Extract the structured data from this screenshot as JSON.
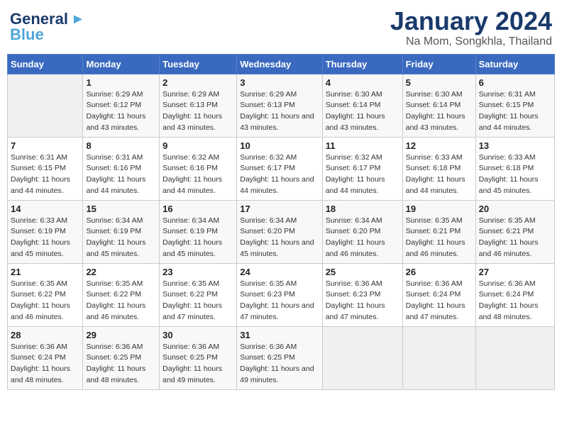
{
  "header": {
    "logo_line1": "General",
    "logo_line2": "Blue",
    "title": "January 2024",
    "subtitle": "Na Mom, Songkhla, Thailand"
  },
  "columns": [
    "Sunday",
    "Monday",
    "Tuesday",
    "Wednesday",
    "Thursday",
    "Friday",
    "Saturday"
  ],
  "weeks": [
    [
      {
        "day": "",
        "sunrise": "",
        "sunset": "",
        "daylight": ""
      },
      {
        "day": "1",
        "sunrise": "Sunrise: 6:29 AM",
        "sunset": "Sunset: 6:12 PM",
        "daylight": "Daylight: 11 hours and 43 minutes."
      },
      {
        "day": "2",
        "sunrise": "Sunrise: 6:29 AM",
        "sunset": "Sunset: 6:13 PM",
        "daylight": "Daylight: 11 hours and 43 minutes."
      },
      {
        "day": "3",
        "sunrise": "Sunrise: 6:29 AM",
        "sunset": "Sunset: 6:13 PM",
        "daylight": "Daylight: 11 hours and 43 minutes."
      },
      {
        "day": "4",
        "sunrise": "Sunrise: 6:30 AM",
        "sunset": "Sunset: 6:14 PM",
        "daylight": "Daylight: 11 hours and 43 minutes."
      },
      {
        "day": "5",
        "sunrise": "Sunrise: 6:30 AM",
        "sunset": "Sunset: 6:14 PM",
        "daylight": "Daylight: 11 hours and 43 minutes."
      },
      {
        "day": "6",
        "sunrise": "Sunrise: 6:31 AM",
        "sunset": "Sunset: 6:15 PM",
        "daylight": "Daylight: 11 hours and 44 minutes."
      }
    ],
    [
      {
        "day": "7",
        "sunrise": "Sunrise: 6:31 AM",
        "sunset": "Sunset: 6:15 PM",
        "daylight": "Daylight: 11 hours and 44 minutes."
      },
      {
        "day": "8",
        "sunrise": "Sunrise: 6:31 AM",
        "sunset": "Sunset: 6:16 PM",
        "daylight": "Daylight: 11 hours and 44 minutes."
      },
      {
        "day": "9",
        "sunrise": "Sunrise: 6:32 AM",
        "sunset": "Sunset: 6:16 PM",
        "daylight": "Daylight: 11 hours and 44 minutes."
      },
      {
        "day": "10",
        "sunrise": "Sunrise: 6:32 AM",
        "sunset": "Sunset: 6:17 PM",
        "daylight": "Daylight: 11 hours and 44 minutes."
      },
      {
        "day": "11",
        "sunrise": "Sunrise: 6:32 AM",
        "sunset": "Sunset: 6:17 PM",
        "daylight": "Daylight: 11 hours and 44 minutes."
      },
      {
        "day": "12",
        "sunrise": "Sunrise: 6:33 AM",
        "sunset": "Sunset: 6:18 PM",
        "daylight": "Daylight: 11 hours and 44 minutes."
      },
      {
        "day": "13",
        "sunrise": "Sunrise: 6:33 AM",
        "sunset": "Sunset: 6:18 PM",
        "daylight": "Daylight: 11 hours and 45 minutes."
      }
    ],
    [
      {
        "day": "14",
        "sunrise": "Sunrise: 6:33 AM",
        "sunset": "Sunset: 6:19 PM",
        "daylight": "Daylight: 11 hours and 45 minutes."
      },
      {
        "day": "15",
        "sunrise": "Sunrise: 6:34 AM",
        "sunset": "Sunset: 6:19 PM",
        "daylight": "Daylight: 11 hours and 45 minutes."
      },
      {
        "day": "16",
        "sunrise": "Sunrise: 6:34 AM",
        "sunset": "Sunset: 6:19 PM",
        "daylight": "Daylight: 11 hours and 45 minutes."
      },
      {
        "day": "17",
        "sunrise": "Sunrise: 6:34 AM",
        "sunset": "Sunset: 6:20 PM",
        "daylight": "Daylight: 11 hours and 45 minutes."
      },
      {
        "day": "18",
        "sunrise": "Sunrise: 6:34 AM",
        "sunset": "Sunset: 6:20 PM",
        "daylight": "Daylight: 11 hours and 46 minutes."
      },
      {
        "day": "19",
        "sunrise": "Sunrise: 6:35 AM",
        "sunset": "Sunset: 6:21 PM",
        "daylight": "Daylight: 11 hours and 46 minutes."
      },
      {
        "day": "20",
        "sunrise": "Sunrise: 6:35 AM",
        "sunset": "Sunset: 6:21 PM",
        "daylight": "Daylight: 11 hours and 46 minutes."
      }
    ],
    [
      {
        "day": "21",
        "sunrise": "Sunrise: 6:35 AM",
        "sunset": "Sunset: 6:22 PM",
        "daylight": "Daylight: 11 hours and 46 minutes."
      },
      {
        "day": "22",
        "sunrise": "Sunrise: 6:35 AM",
        "sunset": "Sunset: 6:22 PM",
        "daylight": "Daylight: 11 hours and 46 minutes."
      },
      {
        "day": "23",
        "sunrise": "Sunrise: 6:35 AM",
        "sunset": "Sunset: 6:22 PM",
        "daylight": "Daylight: 11 hours and 47 minutes."
      },
      {
        "day": "24",
        "sunrise": "Sunrise: 6:35 AM",
        "sunset": "Sunset: 6:23 PM",
        "daylight": "Daylight: 11 hours and 47 minutes."
      },
      {
        "day": "25",
        "sunrise": "Sunrise: 6:36 AM",
        "sunset": "Sunset: 6:23 PM",
        "daylight": "Daylight: 11 hours and 47 minutes."
      },
      {
        "day": "26",
        "sunrise": "Sunrise: 6:36 AM",
        "sunset": "Sunset: 6:24 PM",
        "daylight": "Daylight: 11 hours and 47 minutes."
      },
      {
        "day": "27",
        "sunrise": "Sunrise: 6:36 AM",
        "sunset": "Sunset: 6:24 PM",
        "daylight": "Daylight: 11 hours and 48 minutes."
      }
    ],
    [
      {
        "day": "28",
        "sunrise": "Sunrise: 6:36 AM",
        "sunset": "Sunset: 6:24 PM",
        "daylight": "Daylight: 11 hours and 48 minutes."
      },
      {
        "day": "29",
        "sunrise": "Sunrise: 6:36 AM",
        "sunset": "Sunset: 6:25 PM",
        "daylight": "Daylight: 11 hours and 48 minutes."
      },
      {
        "day": "30",
        "sunrise": "Sunrise: 6:36 AM",
        "sunset": "Sunset: 6:25 PM",
        "daylight": "Daylight: 11 hours and 49 minutes."
      },
      {
        "day": "31",
        "sunrise": "Sunrise: 6:36 AM",
        "sunset": "Sunset: 6:25 PM",
        "daylight": "Daylight: 11 hours and 49 minutes."
      },
      {
        "day": "",
        "sunrise": "",
        "sunset": "",
        "daylight": ""
      },
      {
        "day": "",
        "sunrise": "",
        "sunset": "",
        "daylight": ""
      },
      {
        "day": "",
        "sunrise": "",
        "sunset": "",
        "daylight": ""
      }
    ]
  ]
}
